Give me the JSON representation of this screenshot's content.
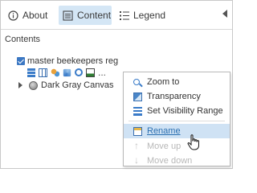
{
  "tabs": {
    "about": "About",
    "content": "Content",
    "legend": "Legend"
  },
  "section_title": "Contents",
  "layers": [
    {
      "label": "master beekeepers reg",
      "checked": true
    }
  ],
  "basemap": {
    "label": "Dark Gray Canvas"
  },
  "layer_tools_more": "...",
  "context_menu": {
    "items": [
      {
        "label": "Zoom to",
        "icon": "zoom-to-icon",
        "enabled": true
      },
      {
        "label": "Transparency",
        "icon": "transparency-icon",
        "enabled": true
      },
      {
        "label": "Set Visibility Range",
        "icon": "visibility-range-icon",
        "enabled": true
      },
      {
        "label": "Rename",
        "icon": "rename-icon",
        "enabled": true,
        "hovered": true
      },
      {
        "label": "Move up",
        "icon": "move-up-icon",
        "enabled": false
      },
      {
        "label": "Move down",
        "icon": "move-down-icon",
        "enabled": false
      }
    ]
  },
  "colors": {
    "selected_tab_bg": "#d4e6f5",
    "hover_item_bg": "#cfe2f4",
    "hover_item_text": "#2a6fb1",
    "disabled_text": "#b8b8b8",
    "checkbox": "#3c78c3"
  }
}
